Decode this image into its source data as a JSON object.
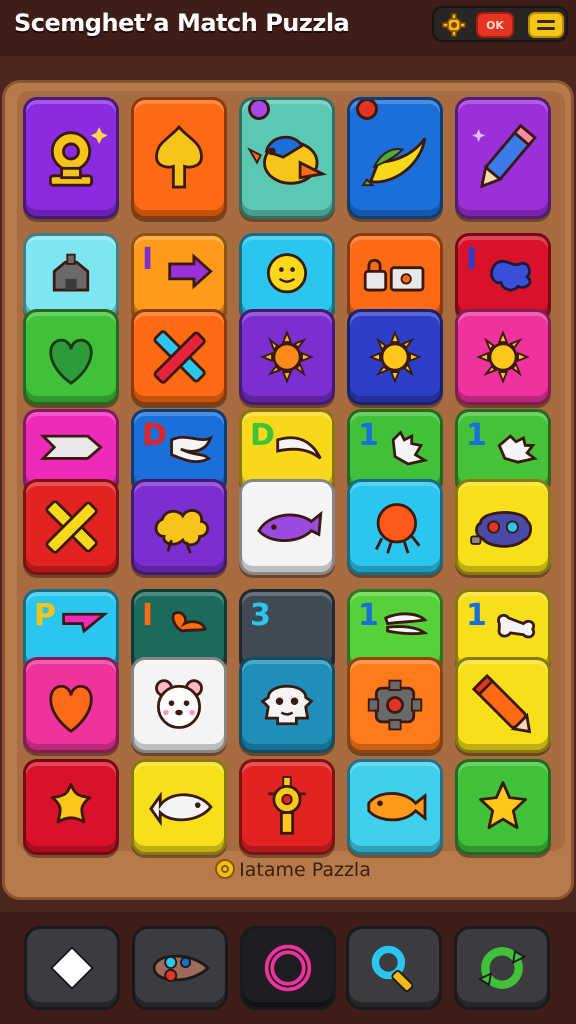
{
  "header": {
    "title": "Scemghet’a Match Puzzla",
    "ok_label": "OK",
    "icons": [
      "gear-icon",
      "menu-icon"
    ]
  },
  "board": {
    "rows": [
      [
        {
          "icon": "trophy-icon",
          "color": "#8a2be2"
        },
        {
          "icon": "leaf-icon",
          "color": "#ff6a13"
        },
        {
          "icon": "bird-icon",
          "color": "#5bc8b4"
        },
        {
          "icon": "banana-icon",
          "color": "#1a6fd8"
        },
        {
          "icon": "pencil-icon",
          "color": "#9b30d9"
        }
      ],
      [
        {
          "icon": "castle-icon",
          "color": "#7ee6f0"
        },
        {
          "icon": "arrow-icon",
          "color": "#ff9a1a",
          "label": "I"
        },
        {
          "icon": "smiley-icon",
          "color": "#2bc6ee"
        },
        {
          "icon": "lock-icon",
          "color": "#ff6a13"
        },
        {
          "icon": "splat-icon",
          "color": "#d9122a",
          "label": "I"
        }
      ],
      [
        {
          "icon": "heart-icon",
          "color": "#3fc23a"
        },
        {
          "icon": "cross-icon",
          "color": "#ff6a13"
        },
        {
          "icon": "sun-icon",
          "color": "#7b2fd0"
        },
        {
          "icon": "sun-icon",
          "color": "#2d3fc8"
        },
        {
          "icon": "sun-icon",
          "color": "#f0329e"
        }
      ],
      [
        {
          "icon": "arrow-icon",
          "color": "#ee2ab8"
        },
        {
          "icon": "swoosh-icon",
          "color": "#1a6fd8",
          "label": "D"
        },
        {
          "icon": "swoosh-icon",
          "color": "#f7d81a",
          "label": "D"
        },
        {
          "icon": "glove-icon",
          "color": "#3fc23a",
          "label": "1"
        },
        {
          "icon": "glove-icon",
          "color": "#45c23a",
          "label": "1"
        }
      ],
      [
        {
          "icon": "cross-icon",
          "color": "#e32222"
        },
        {
          "icon": "splat-icon",
          "color": "#7b2fd0"
        },
        {
          "icon": "fish-icon",
          "color": "#f4f4f4"
        },
        {
          "icon": "ball-icon",
          "color": "#2bc6ee"
        },
        {
          "icon": "gadget-icon",
          "color": "#f7e01a"
        }
      ],
      [
        {
          "icon": "arrow-icon",
          "color": "#2bc6ee",
          "label": "P"
        },
        {
          "icon": "swoosh-icon",
          "color": "#1a6b5e",
          "label": "I"
        },
        {
          "icon": "blank-icon",
          "color": "#3f4a55",
          "label": "3"
        },
        {
          "icon": "swoosh-icon",
          "color": "#56d13a",
          "label": "1"
        },
        {
          "icon": "bone-icon",
          "color": "#f7e01a",
          "label": "1"
        }
      ],
      [
        {
          "icon": "heart-icon",
          "color": "#f0329e"
        },
        {
          "icon": "bear-icon",
          "color": "#f4f4f4"
        },
        {
          "icon": "skull-icon",
          "color": "#1e8fb8"
        },
        {
          "icon": "cog-icon",
          "color": "#ff7a1a"
        },
        {
          "icon": "pencil-icon",
          "color": "#f7e01a"
        }
      ],
      [
        {
          "icon": "star-icon",
          "color": "#d9122a"
        },
        {
          "icon": "fish-icon",
          "color": "#f7e01a"
        },
        {
          "icon": "totem-icon",
          "color": "#e32222"
        },
        {
          "icon": "fish-icon",
          "color": "#3fd0ee"
        },
        {
          "icon": "star-icon",
          "color": "#3fc23a"
        }
      ]
    ]
  },
  "footer": {
    "label": "Iatame Pazzla"
  },
  "toolbar": {
    "buttons": [
      "diamond-icon",
      "palette-icon",
      "ring-icon",
      "magnifier-icon",
      "refresh-icon"
    ]
  }
}
